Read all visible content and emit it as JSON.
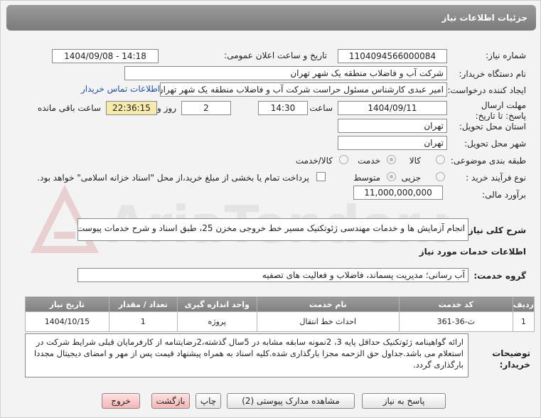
{
  "header": {
    "title": "جزئیات اطلاعات نیاز"
  },
  "fields": {
    "need_number_label": "شماره نیاز:",
    "need_number": "1104094566000084",
    "announce_label": "تاریخ و ساعت اعلان عمومی:",
    "announce_value": "1404/09/08 - 14:18",
    "buyer_org_label": "نام دستگاه خریدار:",
    "buyer_org": "شرکت آب و فاضلاب منطقه یک شهر تهران",
    "creator_label": "ایجاد کننده درخواست:",
    "creator": "امیر عبدی کارشناس مسئول حراست شرکت آب و فاضلاب منطقه یک شهر تهران",
    "buyer_contact_link": "اطلاعات تماس خریدار",
    "deadline_label": "مهلت ارسال پاسخ: تا تاریخ:",
    "deadline_date": "1404/09/11",
    "time_label": "ساعت",
    "deadline_time": "14:30",
    "days_value": "2",
    "days_label": "روز و",
    "remaining_time": "22:36:15",
    "remaining_label": "ساعت باقی مانده",
    "province_label": "استان محل تحویل:",
    "province": "تهران",
    "city_label": "شهر محل تحویل:",
    "city": "تهران",
    "category_label": "طبقه بندی موضوعی:",
    "category_options": [
      "کالا",
      "خدمت",
      "کالا/خدمت"
    ],
    "purchase_type_label": "نوع فرآیند خرید :",
    "purchase_options": [
      "جزیی",
      "متوسط"
    ],
    "payment_note": "پرداخت تمام یا بخشی از مبلغ خرید،از محل \"اسناد خزانه اسلامی\" خواهد بود.",
    "estimate_label": "برآورد مالی:",
    "estimate": "11,000,000,000"
  },
  "description": {
    "label": "شرح کلی نیاز:",
    "value": "انجام آزمایش ها و خدمات مهندسی ژئوتکنیک مسیر خط خروجی مخزن 25، طبق اسناد و شرح خدمات پیوست"
  },
  "services": {
    "section_title": "اطلاعات خدمات مورد نیاز",
    "group_label": "گروه خدمت:",
    "group_value": "آب رسانی؛ مدیریت پسماند، فاضلاب و فعالیت های تصفیه",
    "table": {
      "headers": [
        "ردیف",
        "کد خدمت",
        "نام خدمت",
        "واحد اندازه گیری",
        "تعداد / مقدار",
        "تاریخ نیاز"
      ],
      "rows": [
        [
          "1",
          "ث-36-361",
          "احداث خط انتقال",
          "پروژه",
          "1",
          "1404/10/15"
        ]
      ]
    }
  },
  "buyer_notes": {
    "label": "توضیحات خریدار:",
    "value": "ارائه گواهینامه ژئوتکنیک حداقل پایه 3، 2نمونه سابقه مشابه در 5سال گذشته،2رضایتنامه از کارفرمایان قبلی شرایط شرکت در استعلام می باشد.جداول حق الزحمه مجزا بارگذاری شده.کلیه اسناد به همراه پیشنهاد قیمت پس از مهر و امضای دیجیتال مجددا بارگذاری گردد."
  },
  "buttons": {
    "reply": "پاسخ به نیاز",
    "attachments": "مشاهده مدارک پیوستی (2)",
    "print": "چاپ",
    "back": "بازگشت",
    "exit": "خروج"
  },
  "watermark_text": "AriaTender.net",
  "colors": {
    "header_bg": "#8a8a8a",
    "link": "#1d4fb8",
    "remaining_bg": "#f6ebaa",
    "exit_bg": "#f5b5b5"
  }
}
